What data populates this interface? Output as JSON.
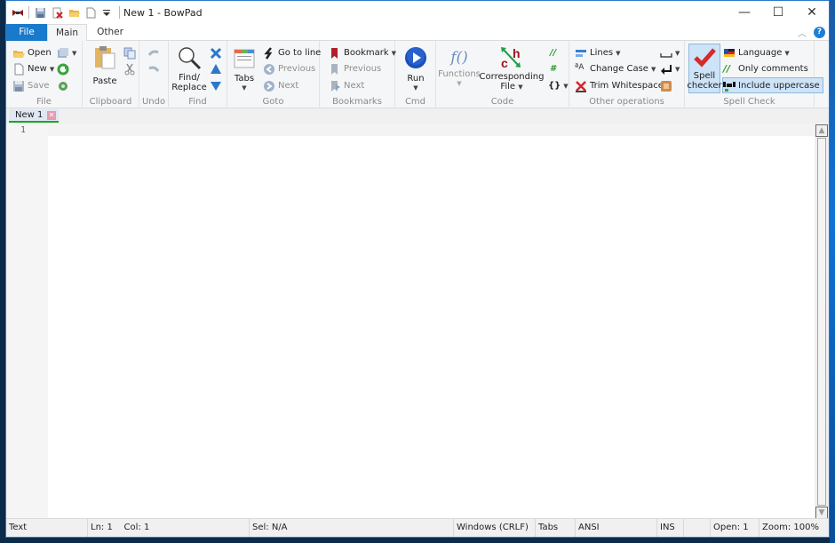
{
  "window": {
    "title": "New 1 - BowPad",
    "controls": {
      "minimize": "—",
      "maximize": "☐",
      "close": "✕"
    }
  },
  "quick_access": {
    "icons": [
      "bowpad-logo-icon",
      "save-icon",
      "close-file-icon",
      "open-folder-icon",
      "new-document-icon",
      "customize-dropdown-icon"
    ]
  },
  "ribbon_tabs": [
    {
      "label": "File",
      "active": false
    },
    {
      "label": "Main",
      "active": true
    },
    {
      "label": "Other",
      "active": false
    }
  ],
  "ribbon": {
    "file": {
      "label": "File",
      "open": "Open",
      "new": "New",
      "save": "Save"
    },
    "clipboard": {
      "label": "Clipboard",
      "paste": "Paste"
    },
    "undo": {
      "label": "Undo"
    },
    "find": {
      "label": "Find",
      "find_replace_1": "Find/",
      "find_replace_2": "Replace"
    },
    "goto": {
      "label": "Goto",
      "tabs": "Tabs",
      "go_to_line": "Go to line",
      "previous": "Previous",
      "next": "Next"
    },
    "bookmarks": {
      "label": "Bookmarks",
      "bookmark": "Bookmark",
      "previous": "Previous",
      "next": "Next"
    },
    "cmd": {
      "label": "Cmd",
      "run": "Run"
    },
    "code": {
      "label": "Code",
      "functions": "Functions",
      "corresponding_1": "Corresponding",
      "corresponding_2": "File",
      "comment_glyph": "//",
      "uncomment_glyph": "#",
      "braces_glyph": "{}"
    },
    "other_operations": {
      "label": "Other operations",
      "lines": "Lines",
      "change_case": "Change Case",
      "trim_whitespaces": "Trim Whitespaces"
    },
    "spell_check": {
      "label": "Spell Check",
      "spell_1": "Spell",
      "spell_2": "checker",
      "language": "Language",
      "only_comments": "Only comments",
      "include_uppercase": "Include uppercase"
    }
  },
  "document_tabs": [
    {
      "label": "New 1",
      "active": true
    }
  ],
  "editor": {
    "line_numbers": [
      "1"
    ],
    "content": ""
  },
  "statusbar": {
    "lexer": "Text",
    "position": "Ln: 1    Col: 1",
    "selection": "Sel: N/A",
    "eol": "Windows (CRLF)",
    "indent": "Tabs",
    "encoding": "ANSI",
    "mode": "INS",
    "open": "Open: 1",
    "zoom": "Zoom: 100%"
  },
  "colors": {
    "accent": "#1979ca",
    "ribbon_bg": "#f5f6f7",
    "active_tab_underline": "#1ea51e"
  }
}
